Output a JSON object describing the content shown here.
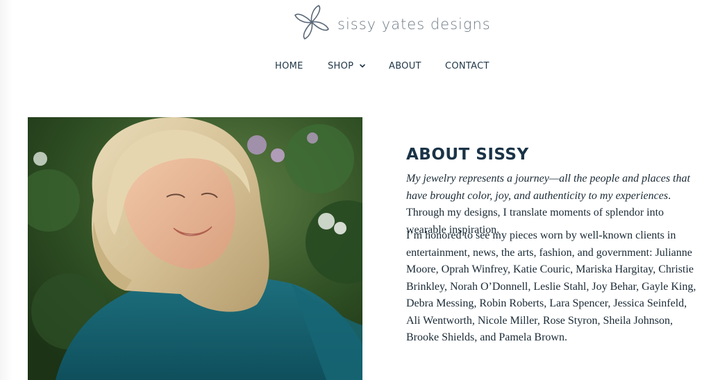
{
  "brand": {
    "name": "sissy yates designs",
    "logo_icon": "pinwheel-flower-icon",
    "accent_color": "#5a6878"
  },
  "nav": {
    "home": "HOME",
    "shop": "SHOP",
    "about": "ABOUT",
    "contact": "CONTACT",
    "shop_icon": "chevron-down-icon"
  },
  "hero_image": {
    "icon": "portrait-photo"
  },
  "about": {
    "title": "ABOUT SISSY",
    "intro_italic": "My jewelry represents a journey—all the people and places that have brought color, joy, and authenticity to my experiences",
    "intro_rest": ". Through my designs, I translate moments of splendor into wearable inspiration.",
    "clients": "I’m honored to see my pieces worn by well-known clients in entertainment, news, the arts, fashion, and government: Julianne Moore, Oprah Winfrey, Katie Couric, Mariska Hargitay, Christie Brinkley, Norah O’Donnell, Leslie Stahl, Joy Behar, Gayle King, Debra Messing, Robin Roberts, Lara Spencer, Jessica Seinfeld, Ali Wentworth, Nicole Miller, Rose Styron, Sheila Johnson, Brooke Shields, and Pamela Brown."
  }
}
